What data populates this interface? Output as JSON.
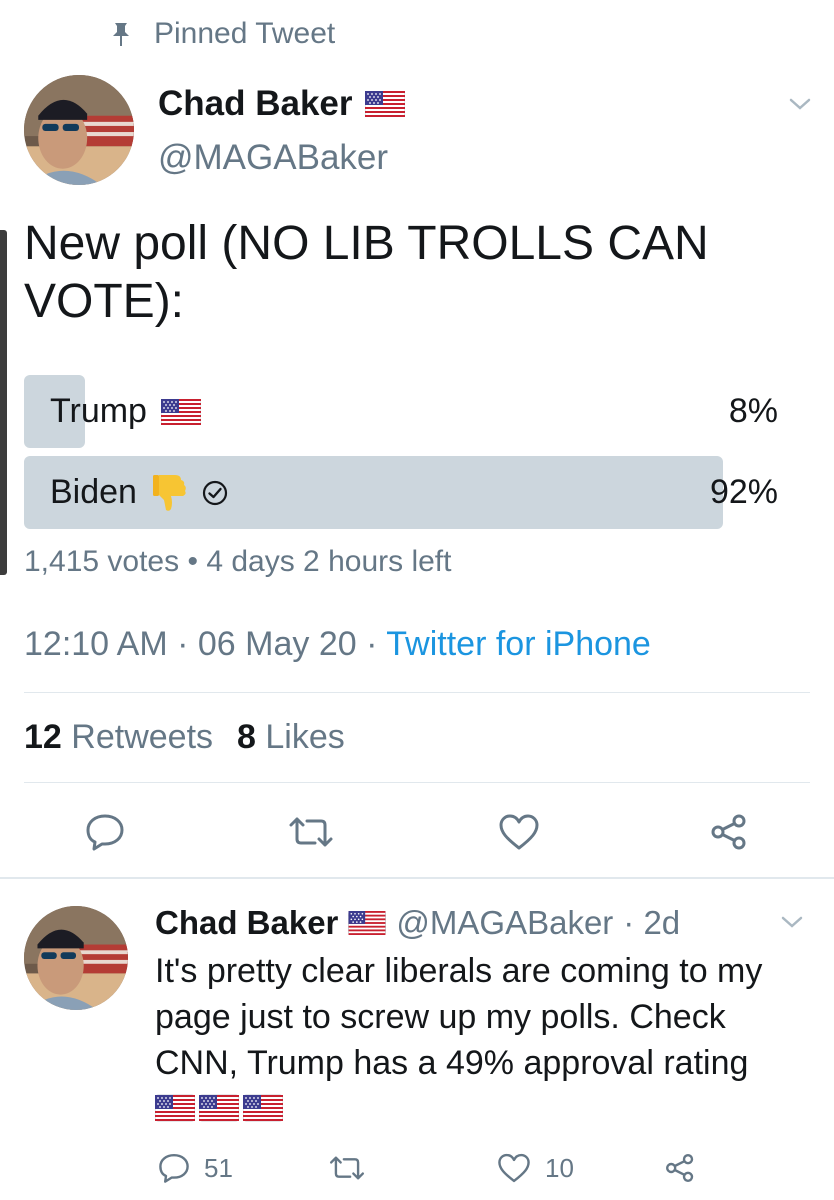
{
  "pinned_label": "Pinned Tweet",
  "tweet": {
    "author_name": "Chad Baker",
    "author_handle": "@MAGABaker",
    "text": "New poll (NO LIB TROLLS CAN VOTE):",
    "poll": {
      "options": [
        {
          "label": "Trump",
          "percent_text": "8%",
          "percent": 8,
          "icon": "us-flag-icon"
        },
        {
          "label": "Biden",
          "percent_text": "92%",
          "percent": 92,
          "icon": "thumbs-down-icon",
          "selected": true
        }
      ],
      "votes": "1,415 votes",
      "separator": "•",
      "time_left": "4 days 2 hours left"
    },
    "time": "12:10 AM",
    "dot1": "·",
    "date": "06 May 20",
    "dot2": "·",
    "client": "Twitter for iPhone",
    "retweets_count": "12",
    "retweets_label": "Retweets",
    "likes_count": "8",
    "likes_label": "Likes"
  },
  "reply": {
    "author_name": "Chad Baker",
    "author_handle": "@MAGABaker",
    "age": "· 2d",
    "text_line1": "It's pretty clear liberals are coming to my",
    "text_line2": "page just to screw up my polls. Check",
    "text_line3": "CNN, Trump has a 49% approval rating",
    "reply_count": "51",
    "like_count": "10"
  },
  "colors": {
    "accent": "#1b95e0",
    "muted": "#657786",
    "poll_fill": "#ccd6dd",
    "divider": "#e1e8ed"
  }
}
